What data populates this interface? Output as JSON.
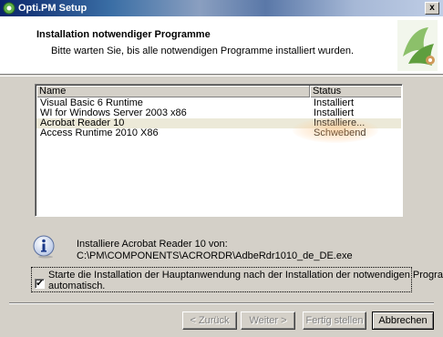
{
  "window": {
    "title": "Opti.PM Setup",
    "close_label": "x"
  },
  "header": {
    "title": "Installation notwendiger Programme",
    "subtitle": "Bitte warten Sie, bis alle notwendigen Programme installiert wurden."
  },
  "list": {
    "columns": {
      "name": "Name",
      "status": "Status"
    },
    "rows": [
      {
        "name": "Visual Basic 6 Runtime",
        "status": "Installiert"
      },
      {
        "name": "WI for Windows Server 2003 x86",
        "status": "Installiert"
      },
      {
        "name": "Acrobat Reader 10",
        "status": "Installiere..."
      },
      {
        "name": "Access Runtime 2010 X86",
        "status": "Schwebend"
      }
    ],
    "highlight_color": "#ece9d8"
  },
  "info": {
    "line1": "Installiere Acrobat Reader 10 von:",
    "line2": "C:\\PM\\COMPONENTS\\ACRORDR\\AdbeRdr1010_de_DE.exe",
    "icon": "info-icon"
  },
  "checkbox": {
    "checked": true,
    "mark": "✔",
    "line1": "Starte die Installation der Hauptanwendung nach der Installation der notwendigen Programme",
    "line2": "automatisch."
  },
  "buttons": {
    "back": "< Zurück",
    "next": "Weiter >",
    "finish": "Fertig stellen",
    "cancel": "Abbrechen"
  },
  "colors": {
    "face": "#d4d0c8",
    "titlebar": "#0a246a",
    "glow": "#ffbe78"
  }
}
